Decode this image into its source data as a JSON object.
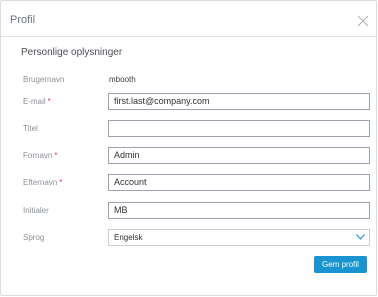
{
  "dialog": {
    "title": "Profil",
    "section_title": "Personlige oplysninger"
  },
  "fields": {
    "username": {
      "label": "Brugernavn",
      "value": "mbooth"
    },
    "email": {
      "label": "E-mail",
      "required": "*",
      "value": "first.last@company.com"
    },
    "title": {
      "label": "Titel",
      "value": ""
    },
    "first_name": {
      "label": "Fornavn",
      "required": "*",
      "value": "Admin"
    },
    "last_name": {
      "label": "Efternavn",
      "required": "*",
      "value": "Account"
    },
    "initials": {
      "label": "Initialer",
      "value": "MB"
    },
    "language": {
      "label": "Sprog",
      "value": "Engelsk"
    }
  },
  "actions": {
    "save_label": "Gem profil"
  },
  "icons": {
    "close": "close-icon",
    "dropdown": "chevron-down-icon"
  },
  "colors": {
    "accent": "#1a93d1",
    "required": "#d9304e"
  }
}
